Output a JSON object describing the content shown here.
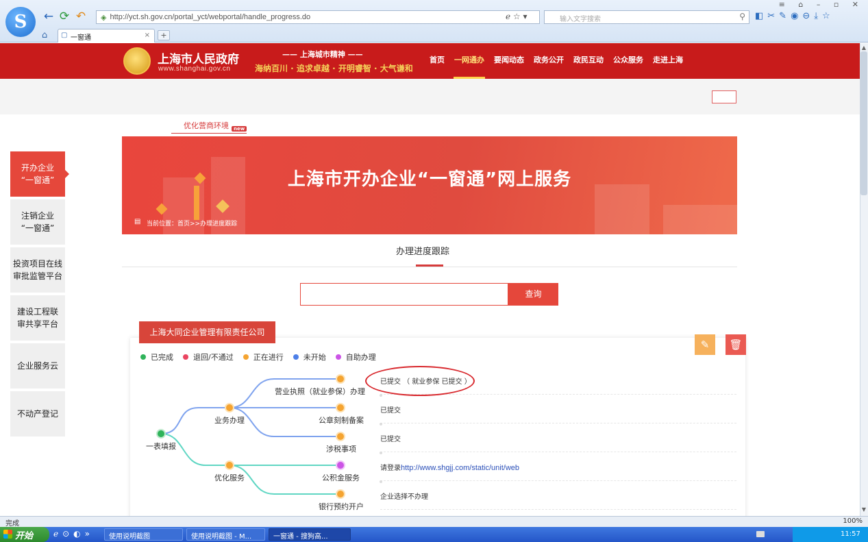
{
  "browser": {
    "url": "http://yct.sh.gov.cn/portal_yct/webportal/handle_progress.do",
    "search_placeholder": "输入文字搜索",
    "tab_title": "一窗通",
    "status_text": "完成",
    "zoom": "100%"
  },
  "site": {
    "gov_title": "上海市人民政府",
    "gov_url": "www.shanghai.gov.cn",
    "spirit_title": "—— 上海城市精神 ——",
    "spirit_sub": "海纳百川 · 追求卓越 · 开明睿智 · 大气谦和",
    "nav": [
      "首页",
      "一网通办",
      "要闻动态",
      "政务公开",
      "政民互动",
      "公众服务",
      "走进上海"
    ],
    "nav_active": "一网通办",
    "promo_label": "优化营商环境",
    "promo_badge": "new"
  },
  "sidebar": [
    {
      "label": "开办企业\n“一窗通”",
      "active": true
    },
    {
      "label": "注销企业\n“一窗通”",
      "active": false
    },
    {
      "label": "投资项目在线\n审批监管平台",
      "active": false
    },
    {
      "label": "建设工程联\n审共享平台",
      "active": false
    },
    {
      "label": "企业服务云",
      "active": false
    },
    {
      "label": "不动产登记",
      "active": false
    }
  ],
  "banner": {
    "title": "上海市开办企业“一窗通”网上服务",
    "breadcrumb": "当前位置：首页>>办理进度跟踪"
  },
  "progress": {
    "title": "办理进度跟踪",
    "search_button": "查询",
    "company_name": "上海大同企业管理有限责任公司"
  },
  "legend": [
    {
      "label": "已完成",
      "color": "#2fb35a"
    },
    {
      "label": "退回/不通过",
      "color": "#ea4561"
    },
    {
      "label": "正在进行",
      "color": "#f5a431"
    },
    {
      "label": "未开始",
      "color": "#4d7fe8"
    },
    {
      "label": "自助办理",
      "color": "#cc54e6"
    }
  ],
  "tree": {
    "root": "一表填报",
    "business": "业务办理",
    "optimize": "优化服务",
    "leaf_license": "营业执照（就业参保）办理",
    "leaf_seal": "公章刻制备案",
    "leaf_tax": "涉税事项",
    "leaf_fund": "公积金服务",
    "leaf_bank": "银行预约开户"
  },
  "statuses": [
    {
      "text": "已提交 （ 就业参保 已提交 ）"
    },
    {
      "text": "已提交"
    },
    {
      "text": "已提交"
    },
    {
      "prefix": "请登录",
      "link": "http://www.shgjj.com/static/unit/web"
    },
    {
      "text": "企业选择不办理"
    }
  ],
  "taskbar": {
    "start": "开始",
    "items": [
      "使用说明截图",
      "使用说明截图 - M...",
      "一窗通 - 搜狗高..."
    ],
    "clock": "11:57"
  }
}
